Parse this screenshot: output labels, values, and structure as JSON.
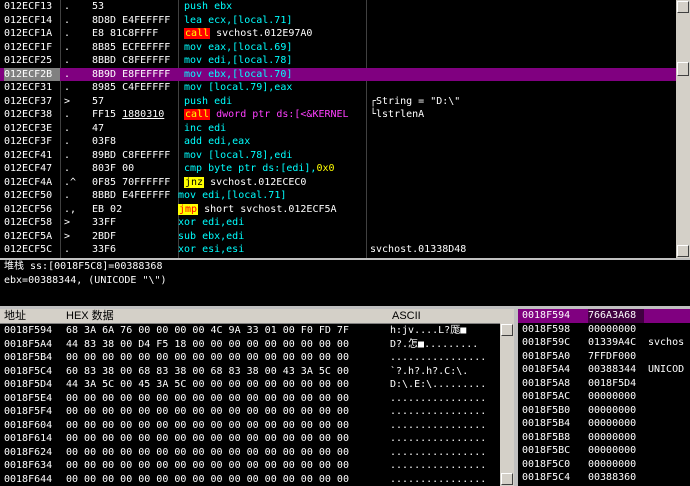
{
  "cpu": {
    "rows": [
      {
        "addr": "012ECF13",
        "mark": ".",
        "hex": "53",
        "asm": [
          {
            "t": "push",
            "c": "t-cyan"
          },
          {
            "t": " ebx",
            "c": "t-cyan"
          }
        ],
        "cmt": ""
      },
      {
        "addr": "012ECF14",
        "mark": ".",
        "hex": "8D8D E4FEFFFF",
        "asm": [
          {
            "t": "lea ecx,[local.71]",
            "c": "t-cyan"
          }
        ],
        "cmt": ""
      },
      {
        "addr": "012ECF1A",
        "mark": ".",
        "hex": "E8 81C8FFFF",
        "asm": [
          {
            "t": "call",
            "c": "hl-call"
          },
          {
            "t": " svchost.012E97A0",
            "c": ""
          }
        ],
        "cmt": ""
      },
      {
        "addr": "012ECF1F",
        "mark": ".",
        "hex": "8B85 ECFEFFFF",
        "asm": [
          {
            "t": "mov eax,[local.69]",
            "c": "t-cyan"
          }
        ],
        "cmt": ""
      },
      {
        "addr": "012ECF25",
        "mark": ".",
        "hex": "8BBD C8FEFFFF",
        "asm": [
          {
            "t": "mov edi,[local.78]",
            "c": "t-cyan"
          }
        ],
        "cmt": ""
      },
      {
        "addr": "012ECF2B",
        "mark": ".",
        "hex": "8B9D E8FEFFFF",
        "asm": [
          {
            "t": "mov ebx,[local.70]",
            "c": "t-cyan"
          }
        ],
        "cmt": "",
        "sel": true
      },
      {
        "addr": "012ECF31",
        "mark": ".",
        "hex": "8985 C4FEFFFF",
        "asm": [
          {
            "t": "mov [local.79],eax",
            "c": "t-cyan"
          }
        ],
        "cmt": ""
      },
      {
        "addr": "012ECF37",
        "mark": ">",
        "hex": "57",
        "asm": [
          {
            "t": "push edi",
            "c": "t-cyan"
          }
        ],
        "cmt": "┌String = \"D:\\\"",
        "cmtc": ""
      },
      {
        "addr": "012ECF38",
        "mark": ".",
        "hex": "FF15 1880310",
        "asm": [
          {
            "t": "call",
            "c": "hl-call"
          },
          {
            "t": " dword ptr ds:[<&KERNEL",
            "c": "t-mag"
          }
        ],
        "cmt": "└lstrlenA",
        "cmtc": "t-red"
      },
      {
        "addr": "012ECF3E",
        "mark": ".",
        "hex": "47",
        "asm": [
          {
            "t": "inc edi",
            "c": "t-cyan"
          }
        ],
        "cmt": ""
      },
      {
        "addr": "012ECF3F",
        "mark": ".",
        "hex": "03F8",
        "asm": [
          {
            "t": "add edi,eax",
            "c": "t-cyan"
          }
        ],
        "cmt": ""
      },
      {
        "addr": "012ECF41",
        "mark": ".",
        "hex": "89BD C8FEFFFF",
        "asm": [
          {
            "t": "mov [local.78],edi",
            "c": "t-cyan"
          }
        ],
        "cmt": ""
      },
      {
        "addr": "012ECF47",
        "mark": ".",
        "hex": "803F 00",
        "asm": [
          {
            "t": "cmp byte ptr ds:[edi],",
            "c": "t-cyan"
          },
          {
            "t": "0x0",
            "c": "t-yellow"
          }
        ],
        "cmt": ""
      },
      {
        "addr": "012ECF4A",
        "mark": ".^",
        "hex": "0F85 70FFFFFF",
        "asm": [
          {
            "t": "jnz",
            "c": "hl-jnz"
          },
          {
            "t": " svchost.012ECEC0",
            "c": ""
          }
        ],
        "cmt": ""
      },
      {
        "addr": "012ECF50",
        "mark": ".",
        "hex": "8BBD E4FEFFFF",
        "asm": [
          {
            "t": "mov edi,[local.71]",
            "c": "t-cyan",
            "shift": true
          }
        ],
        "cmt": ""
      },
      {
        "addr": "012ECF56",
        "mark": ".,",
        "hex": "EB 02",
        "asm": [
          {
            "t": "jmp",
            "c": "hl-jmp"
          },
          {
            "t": " short svchost.012ECF5A",
            "c": ""
          }
        ],
        "cmt": "",
        "shift": true
      },
      {
        "addr": "012ECF58",
        "mark": ">",
        "hex": "33FF",
        "asm": [
          {
            "t": "xor edi,edi",
            "c": "t-cyan"
          }
        ],
        "cmt": "",
        "shift": true
      },
      {
        "addr": "012ECF5A",
        "mark": ">",
        "hex": "2BDF",
        "asm": [
          {
            "t": "sub ebx,edi",
            "c": "t-cyan"
          }
        ],
        "cmt": "",
        "shift": true
      },
      {
        "addr": "012ECF5C",
        "mark": ".",
        "hex": "33F6",
        "asm": [
          {
            "t": "xor esi,esi",
            "c": "t-cyan"
          }
        ],
        "cmt": "svchost.01338D48",
        "shift": true
      }
    ]
  },
  "info": {
    "line1": "堆栈 ss:[0018F5C8]=00388368",
    "line2": "ebx=00388344, (UNICODE \"\\\")"
  },
  "dump": {
    "header": {
      "addr": "地址",
      "hex": "HEX 数据",
      "ascii": "ASCII"
    },
    "rows": [
      {
        "addr": "0018F594",
        "hex": "68 3A 6A 76 00 00 00 00 4C 9A 33 01 00 F0 FD 7F",
        "ascii": "h:jv....L?厖■"
      },
      {
        "addr": "0018F5A4",
        "hex": "44 83 38 00 D4 F5 18 00 00 00 00 00 00 00 00 00",
        "ascii": "D?.怎■........."
      },
      {
        "addr": "0018F5B4",
        "hex": "00 00 00 00 00 00 00 00 00 00 00 00 00 00 00 00",
        "ascii": "................"
      },
      {
        "addr": "0018F5C4",
        "hex": "60 83 38 00 68 83 38 00 68 83 38 00 43 3A 5C 00",
        "ascii": "`?.h?.h?.C:\\."
      },
      {
        "addr": "0018F5D4",
        "hex": "44 3A 5C 00 45 3A 5C 00 00 00 00 00 00 00 00 00",
        "ascii": "D:\\.E:\\........."
      },
      {
        "addr": "0018F5E4",
        "hex": "00 00 00 00 00 00 00 00 00 00 00 00 00 00 00 00",
        "ascii": "................"
      },
      {
        "addr": "0018F5F4",
        "hex": "00 00 00 00 00 00 00 00 00 00 00 00 00 00 00 00",
        "ascii": "................"
      },
      {
        "addr": "0018F604",
        "hex": "00 00 00 00 00 00 00 00 00 00 00 00 00 00 00 00",
        "ascii": "................"
      },
      {
        "addr": "0018F614",
        "hex": "00 00 00 00 00 00 00 00 00 00 00 00 00 00 00 00",
        "ascii": "................"
      },
      {
        "addr": "0018F624",
        "hex": "00 00 00 00 00 00 00 00 00 00 00 00 00 00 00 00",
        "ascii": "................"
      },
      {
        "addr": "0018F634",
        "hex": "00 00 00 00 00 00 00 00 00 00 00 00 00 00 00 00",
        "ascii": "................"
      },
      {
        "addr": "0018F644",
        "hex": "00 00 00 00 00 00 00 00 00 00 00 00 00 00 00 00",
        "ascii": "................"
      }
    ]
  },
  "stack": {
    "rows": [
      {
        "addr": "0018F594",
        "val": "766A3A68",
        "cmt": ""
      },
      {
        "addr": "0018F598",
        "val": "00000000",
        "cmt": ""
      },
      {
        "addr": "0018F59C",
        "val": "01339A4C",
        "cmt": "svchos"
      },
      {
        "addr": "0018F5A0",
        "val": "7FFDF000",
        "cmt": ""
      },
      {
        "addr": "0018F5A4",
        "val": "00388344",
        "cmt": "UNICOD"
      },
      {
        "addr": "0018F5A8",
        "val": "0018F5D4",
        "cmt": ""
      },
      {
        "addr": "0018F5AC",
        "val": "00000000",
        "cmt": ""
      },
      {
        "addr": "0018F5B0",
        "val": "00000000",
        "cmt": ""
      },
      {
        "addr": "0018F5B4",
        "val": "00000000",
        "cmt": ""
      },
      {
        "addr": "0018F5B8",
        "val": "00000000",
        "cmt": ""
      },
      {
        "addr": "0018F5BC",
        "val": "00000000",
        "cmt": ""
      },
      {
        "addr": "0018F5C0",
        "val": "00000000",
        "cmt": ""
      },
      {
        "addr": "0018F5C4",
        "val": "00388360",
        "cmt": ""
      }
    ]
  }
}
